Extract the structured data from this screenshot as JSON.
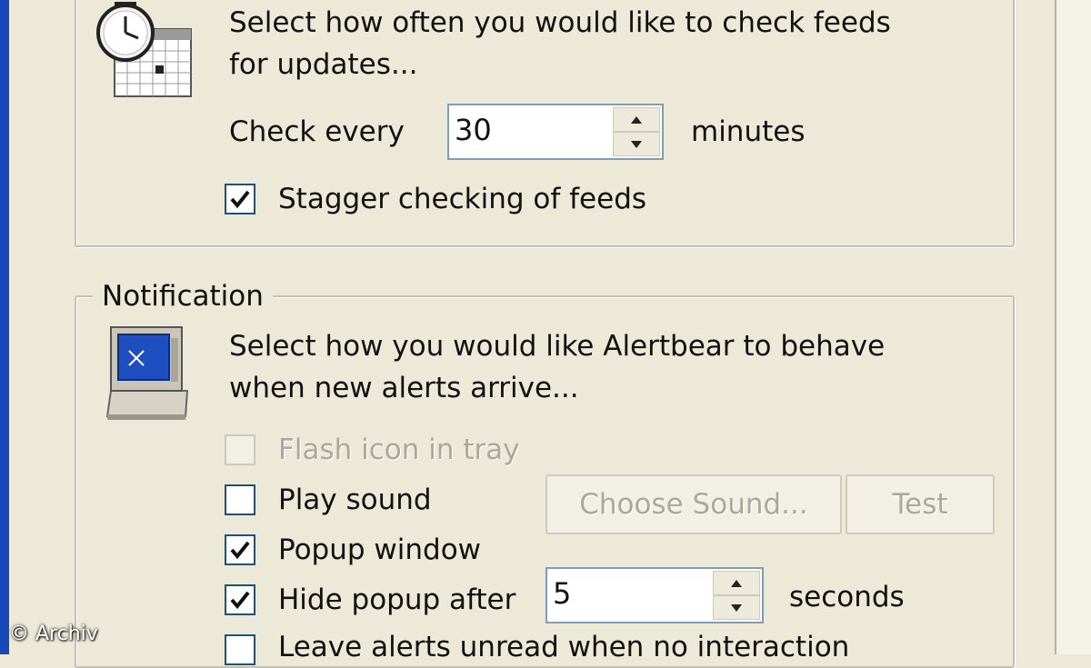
{
  "updates": {
    "description_line1": "Select how often you would like to check feeds",
    "description_line2": "for updates...",
    "interval_label": "Check every",
    "interval_value": "30",
    "interval_unit": "minutes",
    "stagger_label": "Stagger checking of feeds",
    "stagger_checked": true,
    "icon": "clock-calendar-icon"
  },
  "notification": {
    "legend": "Notification",
    "description_line1": "Select how you would like Alertbear to behave",
    "description_line2": "when new alerts arrive...",
    "icon": "computer-monitor-icon",
    "options": {
      "flash_icon": {
        "label": "Flash icon in tray",
        "checked": false,
        "enabled": false
      },
      "play_sound": {
        "label": "Play sound",
        "checked": false,
        "enabled": true
      },
      "popup_window": {
        "label": "Popup window",
        "checked": true,
        "enabled": true
      },
      "hide_popup": {
        "label": "Hide popup after",
        "checked": true,
        "enabled": true
      },
      "leave_unread": {
        "label": "Leave alerts unread when no interaction",
        "checked": false,
        "enabled": true
      }
    },
    "choose_sound_label": "Choose Sound...",
    "test_label": "Test",
    "hide_after_value": "5",
    "hide_after_unit": "seconds"
  },
  "watermark": "© Archiv",
  "colors": {
    "window_bg": "#ece9d8",
    "checkbox_border": "#1c5180",
    "disabled_text": "#aca899",
    "xp_blue": "#1748b8"
  }
}
